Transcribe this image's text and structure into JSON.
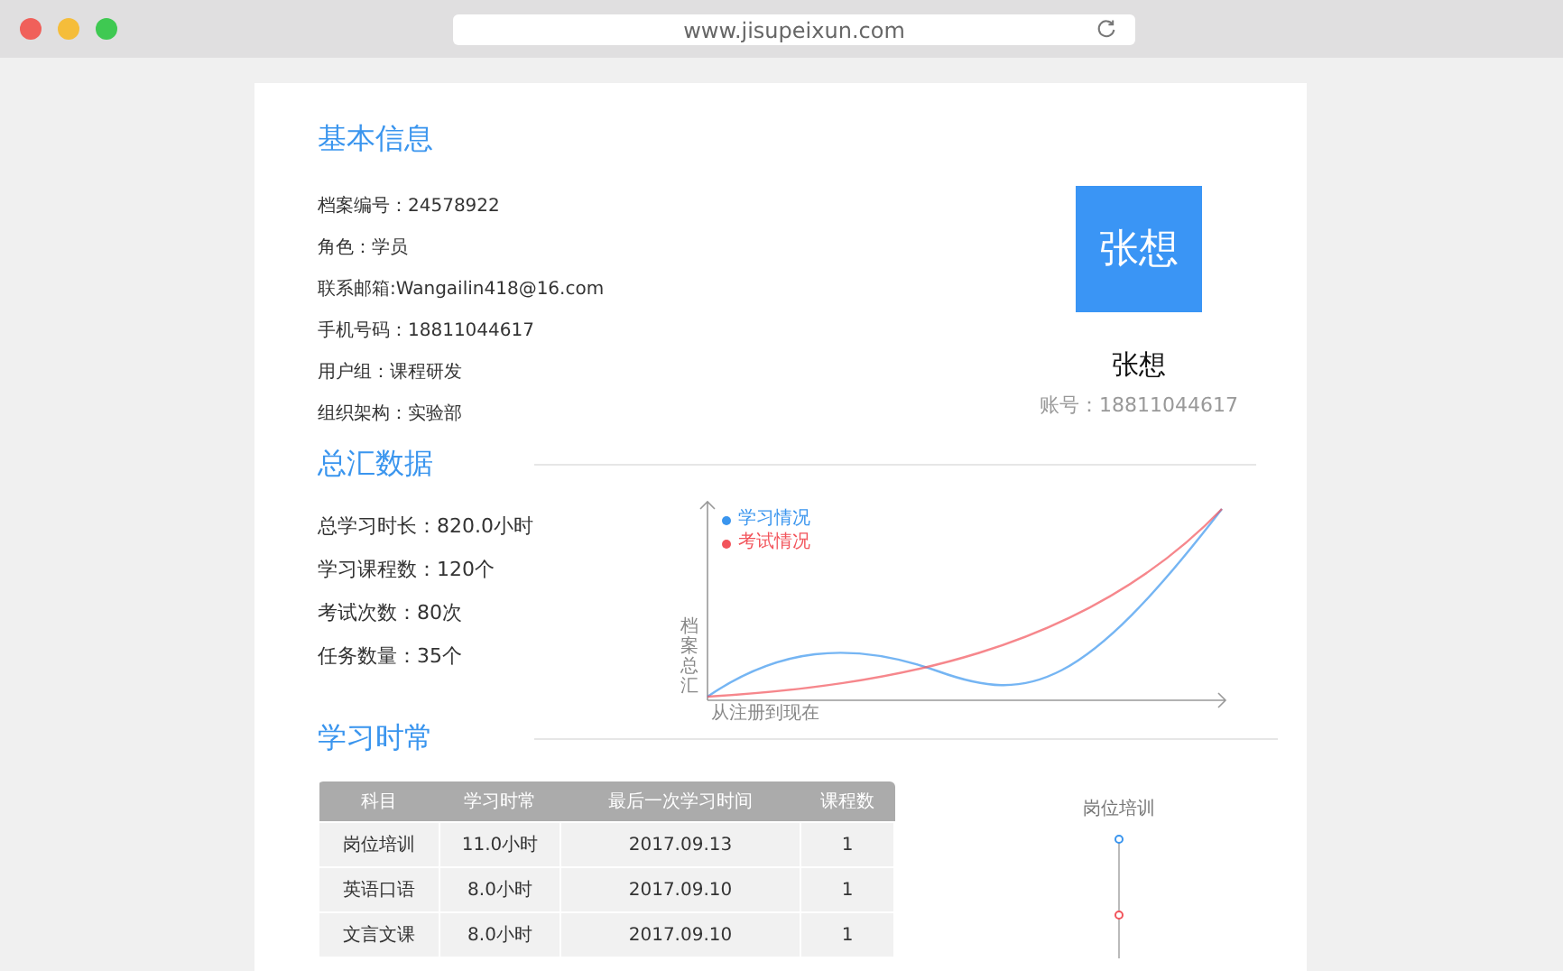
{
  "browser": {
    "url": "www.jisupeixun.com"
  },
  "basic_info": {
    "title": "基本信息",
    "fields": [
      "档案编号：24578922",
      "角色：学员",
      "联系邮箱:Wangailin418@16.com",
      "手机号码：18811044617",
      "用户组：课程研发",
      "组织架构：实验部"
    ]
  },
  "profile": {
    "avatar_text": "张想",
    "name": "张想",
    "account": "账号：18811044617"
  },
  "summary": {
    "title": "总汇数据",
    "stats": [
      "总学习时长：820.0小时",
      "学习课程数：120个",
      "考试次数：80次",
      "任务数量：35个"
    ],
    "chart": {
      "legend": [
        {
          "label": "学习情况",
          "color": "#3a95ee"
        },
        {
          "label": "考试情况",
          "color": "#f2545b"
        }
      ],
      "y_label": "档案总汇",
      "x_label": "从注册到现在"
    }
  },
  "study": {
    "title": "学习时常",
    "table": {
      "columns": [
        "科目",
        "学习时常",
        "最后一次学习时间",
        "课程数"
      ],
      "rows": [
        [
          "岗位培训",
          "11.0小时",
          "2017.09.13",
          "1"
        ],
        [
          "英语口语",
          "8.0小时",
          "2017.09.10",
          "1"
        ],
        [
          "文言文课",
          "8.0小时",
          "2017.09.10",
          "1"
        ]
      ]
    },
    "timeline": {
      "label": "岗位培训"
    }
  }
}
